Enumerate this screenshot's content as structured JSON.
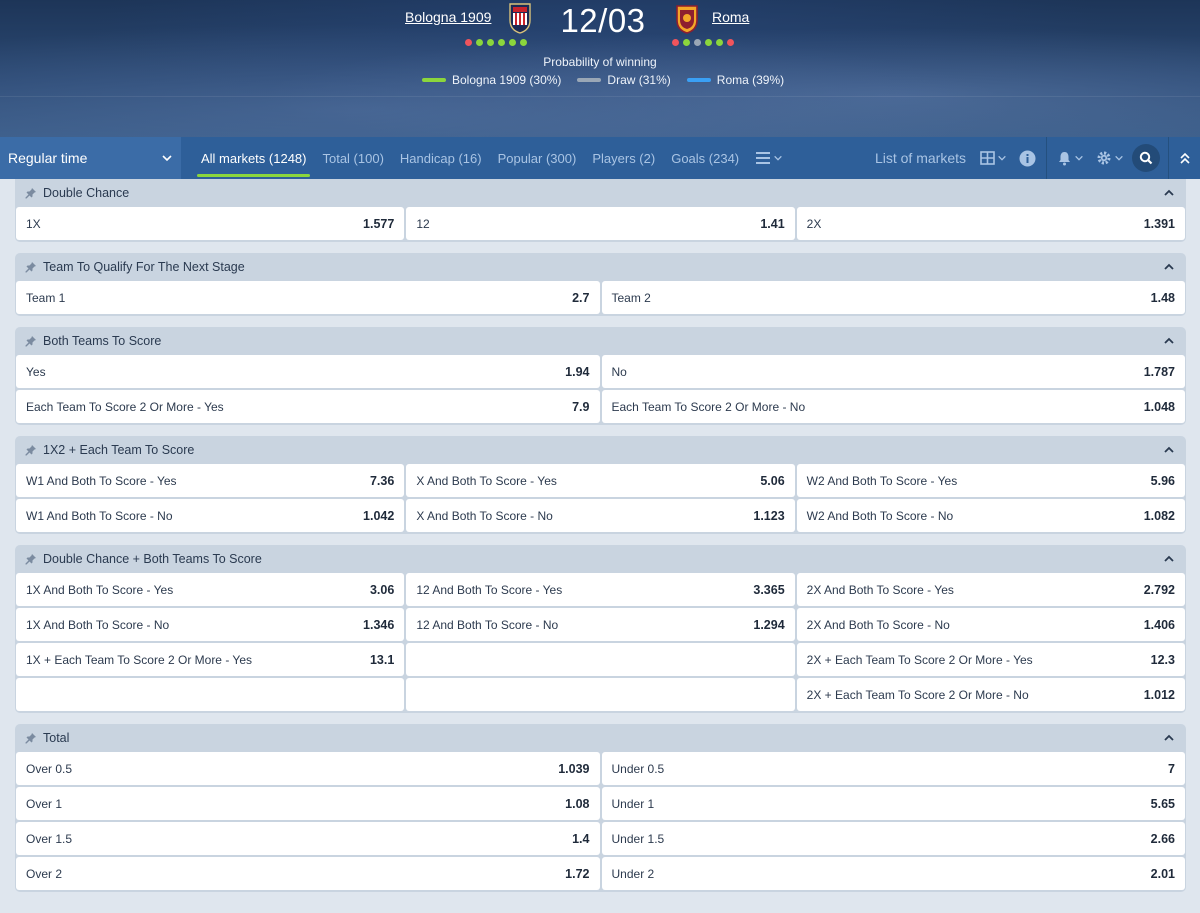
{
  "header": {
    "home_team": "Bologna 1909",
    "away_team": "Roma",
    "date": "12/03",
    "home_form": [
      "l",
      "w",
      "w",
      "w",
      "w",
      "w"
    ],
    "away_form": [
      "l",
      "w",
      "d",
      "w",
      "w",
      "l"
    ],
    "prob_title": "Probability of winning",
    "probabilities": [
      {
        "label": "Bologna 1909 (30%)",
        "color": "#8bd63c"
      },
      {
        "label": "Draw (31%)",
        "color": "#9aa7b6"
      },
      {
        "label": "Roma (39%)",
        "color": "#3aa0f5"
      }
    ]
  },
  "toolbar": {
    "period": "Regular time",
    "tabs": [
      {
        "label": "All markets (1248)",
        "active": true
      },
      {
        "label": "Total (100)"
      },
      {
        "label": "Handicap (16)"
      },
      {
        "label": "Popular (300)"
      },
      {
        "label": "Players (2)"
      },
      {
        "label": "Goals (234)"
      }
    ],
    "list_markets": "List of markets"
  },
  "markets": [
    {
      "title": "Double Chance",
      "cols": 3,
      "cells": [
        {
          "label": "1X",
          "odd": "1.577"
        },
        {
          "label": "12",
          "odd": "1.41"
        },
        {
          "label": "2X",
          "odd": "1.391"
        }
      ]
    },
    {
      "title": "Team To Qualify For The Next Stage",
      "cols": 2,
      "cells": [
        {
          "label": "Team 1",
          "odd": "2.7"
        },
        {
          "label": "Team 2",
          "odd": "1.48"
        }
      ]
    },
    {
      "title": "Both Teams To Score",
      "cols": 2,
      "cells": [
        {
          "label": "Yes",
          "odd": "1.94"
        },
        {
          "label": "No",
          "odd": "1.787"
        },
        {
          "label": "Each Team To Score 2 Or More - Yes",
          "odd": "7.9"
        },
        {
          "label": "Each Team To Score 2 Or More - No",
          "odd": "1.048"
        }
      ]
    },
    {
      "title": "1X2 + Each Team To Score",
      "cols": 3,
      "cells": [
        {
          "label": "W1 And Both To Score - Yes",
          "odd": "7.36"
        },
        {
          "label": "X And Both To Score - Yes",
          "odd": "5.06"
        },
        {
          "label": "W2 And Both To Score - Yes",
          "odd": "5.96"
        },
        {
          "label": "W1 And Both To Score - No",
          "odd": "1.042"
        },
        {
          "label": "X And Both To Score - No",
          "odd": "1.123"
        },
        {
          "label": "W2 And Both To Score - No",
          "odd": "1.082"
        }
      ]
    },
    {
      "title": "Double Chance + Both Teams To Score",
      "cols": 3,
      "cells": [
        {
          "label": "1X And Both To Score - Yes",
          "odd": "3.06"
        },
        {
          "label": "12 And Both To Score - Yes",
          "odd": "3.365"
        },
        {
          "label": "2X And Both To Score - Yes",
          "odd": "2.792"
        },
        {
          "label": "1X And Both To Score - No",
          "odd": "1.346"
        },
        {
          "label": "12 And Both To Score - No",
          "odd": "1.294"
        },
        {
          "label": "2X And Both To Score - No",
          "odd": "1.406"
        },
        {
          "label": "1X + Each Team To Score 2 Or More - Yes",
          "odd": "13.1"
        },
        {
          "label": "",
          "odd": ""
        },
        {
          "label": "2X + Each Team To Score 2 Or More - Yes",
          "odd": "12.3"
        },
        {
          "label": "",
          "odd": ""
        },
        {
          "label": "",
          "odd": ""
        },
        {
          "label": "2X + Each Team To Score 2 Or More - No",
          "odd": "1.012"
        }
      ]
    },
    {
      "title": "Total",
      "cols": 2,
      "cells": [
        {
          "label": "Over 0.5",
          "odd": "1.039"
        },
        {
          "label": "Under 0.5",
          "odd": "7"
        },
        {
          "label": "Over 1",
          "odd": "1.08"
        },
        {
          "label": "Under 1",
          "odd": "5.65"
        },
        {
          "label": "Over 1.5",
          "odd": "1.4"
        },
        {
          "label": "Under 1.5",
          "odd": "2.66"
        },
        {
          "label": "Over 2",
          "odd": "1.72"
        },
        {
          "label": "Under 2",
          "odd": "2.01"
        }
      ]
    }
  ]
}
